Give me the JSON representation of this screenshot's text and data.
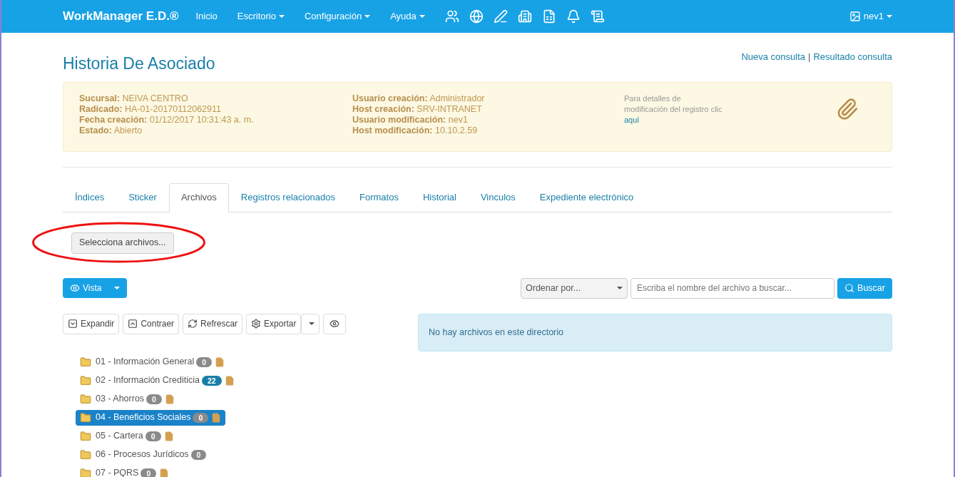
{
  "navbar": {
    "brand": "WorkManager E.D.®",
    "menu": [
      {
        "label": "Inicio",
        "dropdown": false
      },
      {
        "label": "Escritorio",
        "dropdown": true
      },
      {
        "label": "Configuración",
        "dropdown": true
      },
      {
        "label": "Ayuda",
        "dropdown": true
      }
    ],
    "user": "nev1"
  },
  "header": {
    "title": "Historia De Asociado",
    "links": [
      "Nueva consulta",
      "Resultado consulta"
    ],
    "separator": "|"
  },
  "info": {
    "column_1": [
      {
        "label": "Sucursal:",
        "value": "NEIVA CENTRO"
      },
      {
        "label": "Radicado:",
        "value": "HA-01-20170112062911"
      },
      {
        "label": "Fecha creación:",
        "value": "01/12/2017 10:31:43 a. m."
      },
      {
        "label": "Estado:",
        "value": "Abierto"
      }
    ],
    "column_2": [
      {
        "label": "Usuario creación:",
        "value": "Administrador"
      },
      {
        "label": "Host creación:",
        "value": "SRV-INTRANET"
      },
      {
        "label": "Usuario modificación:",
        "value": "nev1"
      },
      {
        "label": "Host modificación:",
        "value": "10.10.2.59"
      }
    ],
    "note": "Para detalles de modificación del registro clic",
    "note_link": "aquí"
  },
  "tabs": [
    {
      "label": "Índices",
      "selected": false
    },
    {
      "label": "Sticker",
      "selected": false
    },
    {
      "label": "Archivos",
      "selected": true
    },
    {
      "label": "Registros relacionados",
      "selected": false
    },
    {
      "label": "Formatos",
      "selected": false
    },
    {
      "label": "Historial",
      "selected": false
    },
    {
      "label": "Vinculos",
      "selected": false
    },
    {
      "label": "Expediente electrónico",
      "selected": false
    }
  ],
  "file_button": "Selecciona archivos...",
  "view_button": "Vista",
  "sort_select": "Ordenar por...",
  "search": {
    "placeholder": "Escriba el nombre del archivo a buscar...",
    "button": "Buscar"
  },
  "toolbar": [
    "Expandir",
    "Contraer",
    "Refrescar",
    "Exportar"
  ],
  "alert": "No hay archivos en este directorio",
  "tree": [
    {
      "label": "01 - Información General",
      "count": "0",
      "color": "#8a8a8a",
      "has_file": true,
      "selected": false
    },
    {
      "label": "02 - Información Crediticia",
      "count": "22",
      "color": "#1a7fa8",
      "has_file": true,
      "selected": false
    },
    {
      "label": "03 - Ahorros",
      "count": "0",
      "color": "#8a8a8a",
      "has_file": true,
      "selected": false
    },
    {
      "label": "04 - Beneficios Sociales",
      "count": "0",
      "color": "#8a8a8a",
      "has_file": true,
      "selected": true
    },
    {
      "label": "05 - Cartera",
      "count": "0",
      "color": "#8a8a8a",
      "has_file": true,
      "selected": false
    },
    {
      "label": "06 - Procesos Jurídicos",
      "count": "0",
      "color": "#8a8a8a",
      "has_file": false,
      "selected": false
    },
    {
      "label": "07 - PQRS",
      "count": "0",
      "color": "#8a8a8a",
      "has_file": true,
      "selected": false
    }
  ]
}
